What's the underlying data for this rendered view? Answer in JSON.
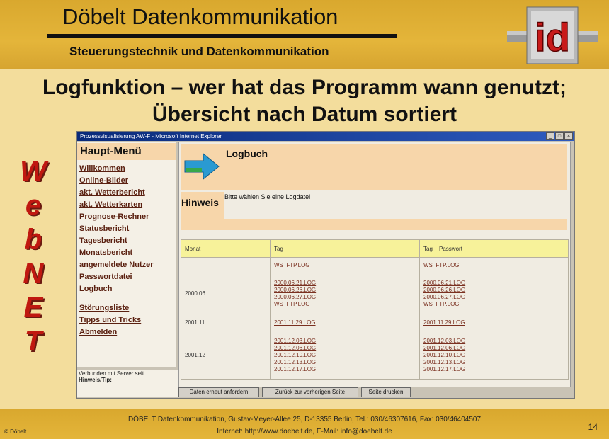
{
  "header": {
    "title": "Döbelt Datenkommunikation",
    "subtitle": "Steuerungstechnik und Datenkommunikation",
    "logo_text": "id"
  },
  "headline": {
    "line1": "Logfunktion – wer hat das Programm wann genutzt;",
    "line2": "Übersicht nach Datum sortiert"
  },
  "side_letters": [
    "W",
    "e",
    "b",
    "N",
    "E",
    "T"
  ],
  "window": {
    "title": "Prozessvisualisierung AW-F - Microsoft Internet Explorer",
    "menu": {
      "heading": "Haupt-Menü",
      "items1": [
        "Willkommen",
        "Online-Bilder",
        "akt. Wetterbericht",
        "akt. Wetterkarten",
        "Prognose-Rechner",
        "Statusbericht",
        "Tagesbericht",
        "Monatsbericht",
        "angemeldete Nutzer",
        "Passwortdatei",
        "Logbuch"
      ],
      "items2": [
        "Störungsliste",
        "Tipps und Tricks",
        "Abmelden"
      ]
    },
    "status": {
      "line1": "Verbunden mit Server seit",
      "line2": "Hinweis/Tip:"
    },
    "logbook_title": "Logbuch",
    "hint_label": "Hinweis",
    "hint_text": "Bitte wählen Sie eine Logdatei",
    "table": {
      "headers": [
        "Monat",
        "Tag",
        "Tag + Passwort"
      ],
      "rows": [
        {
          "month": "",
          "days": [
            "WS_FTP.LOG"
          ],
          "pw": [
            "WS_FTP.LOG"
          ]
        },
        {
          "month": "2000.06",
          "days": [
            "2000.06.21.LOG",
            "2000.06.26.LOG",
            "2000.06.27.LOG",
            "WS_FTP.LOG"
          ],
          "pw": [
            "2000.06.21.LOG",
            "2000.06.26.LOG",
            "2000.06.27.LOG",
            "WS_FTP.LOG"
          ]
        },
        {
          "month": "2001.11",
          "days": [
            "2001.11.29.LOG"
          ],
          "pw": [
            "2001.11.29.LOG"
          ]
        },
        {
          "month": "2001.12",
          "days": [
            "2001.12.03.LOG",
            "2001.12.06.LOG",
            "2001.12.10.LOG",
            "2001.12.13.LOG",
            "2001.12.17.LOG"
          ],
          "pw": [
            "2001.12.03.LOG",
            "2001.12.06.LOG",
            "2001.12.10.LOG",
            "2001.12.13.LOG",
            "2001.12.17.LOG"
          ]
        }
      ]
    },
    "buttons": [
      "Daten erneut anfordern",
      "Zurück zur vorherigen Seite",
      "Seite drucken"
    ]
  },
  "footer": {
    "line1": "DÖBELT Datenkommunikation, Gustav-Meyer-Allee 25, D-13355 Berlin, Tel.: 030/46307616, Fax: 030/46404507",
    "line2": "Internet: http://www.doebelt.de, E-Mail: info@doebelt.de",
    "copyright": "© Döbelt",
    "page": "14"
  }
}
